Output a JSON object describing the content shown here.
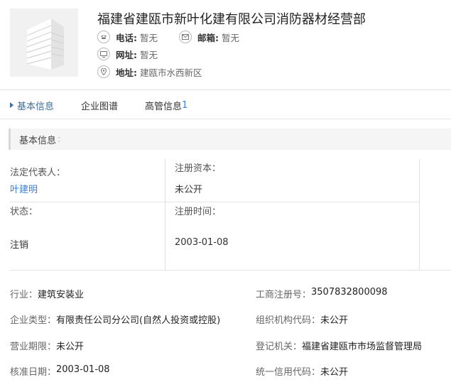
{
  "company": {
    "name": "福建省建瓯市新叶化建有限公司消防器材经营部"
  },
  "contact": {
    "phone_label": "电话:",
    "phone_value": "暂无",
    "email_label": "邮箱:",
    "email_value": "暂无",
    "website_label": "网址:",
    "website_value": "暂无",
    "address_label": "地址:",
    "address_value": "建瓯市水西新区"
  },
  "tabs": [
    {
      "label": "基本信息",
      "active": true
    },
    {
      "label": "企业图谱"
    },
    {
      "label": "高管信息",
      "count": "1"
    }
  ],
  "section": {
    "title": "基本信息",
    "colon": ":"
  },
  "grid": {
    "legal_rep_label": "法定代表人：",
    "legal_rep_value": "叶建明",
    "capital_label": "注册资本：",
    "capital_value": "未公开",
    "status_label": "状态：",
    "status_value": "注销",
    "reg_time_label": "注册时间：",
    "reg_time_value": "2003-01-08"
  },
  "details": {
    "industry_label": "行业：",
    "industry_value": "建筑安装业",
    "reg_no_label": "工商注册号：",
    "reg_no_value": "3507832800098",
    "type_label": "企业类型：",
    "type_value": "有限责任公司分公司(自然人投资或控股)",
    "org_code_label": "组织机构代码：",
    "org_code_value": "未公开",
    "term_label": "营业期限：",
    "term_value": "未公开",
    "authority_label": "登记机关：",
    "authority_value": "福建省建瓯市市场监督管理局",
    "approval_label": "核准日期：",
    "approval_value": "2003-01-08",
    "credit_label": "统一信用代码：",
    "credit_value": "未公开"
  },
  "colors": {
    "accent": "#3f6f9e",
    "link": "#3f7fd4"
  }
}
